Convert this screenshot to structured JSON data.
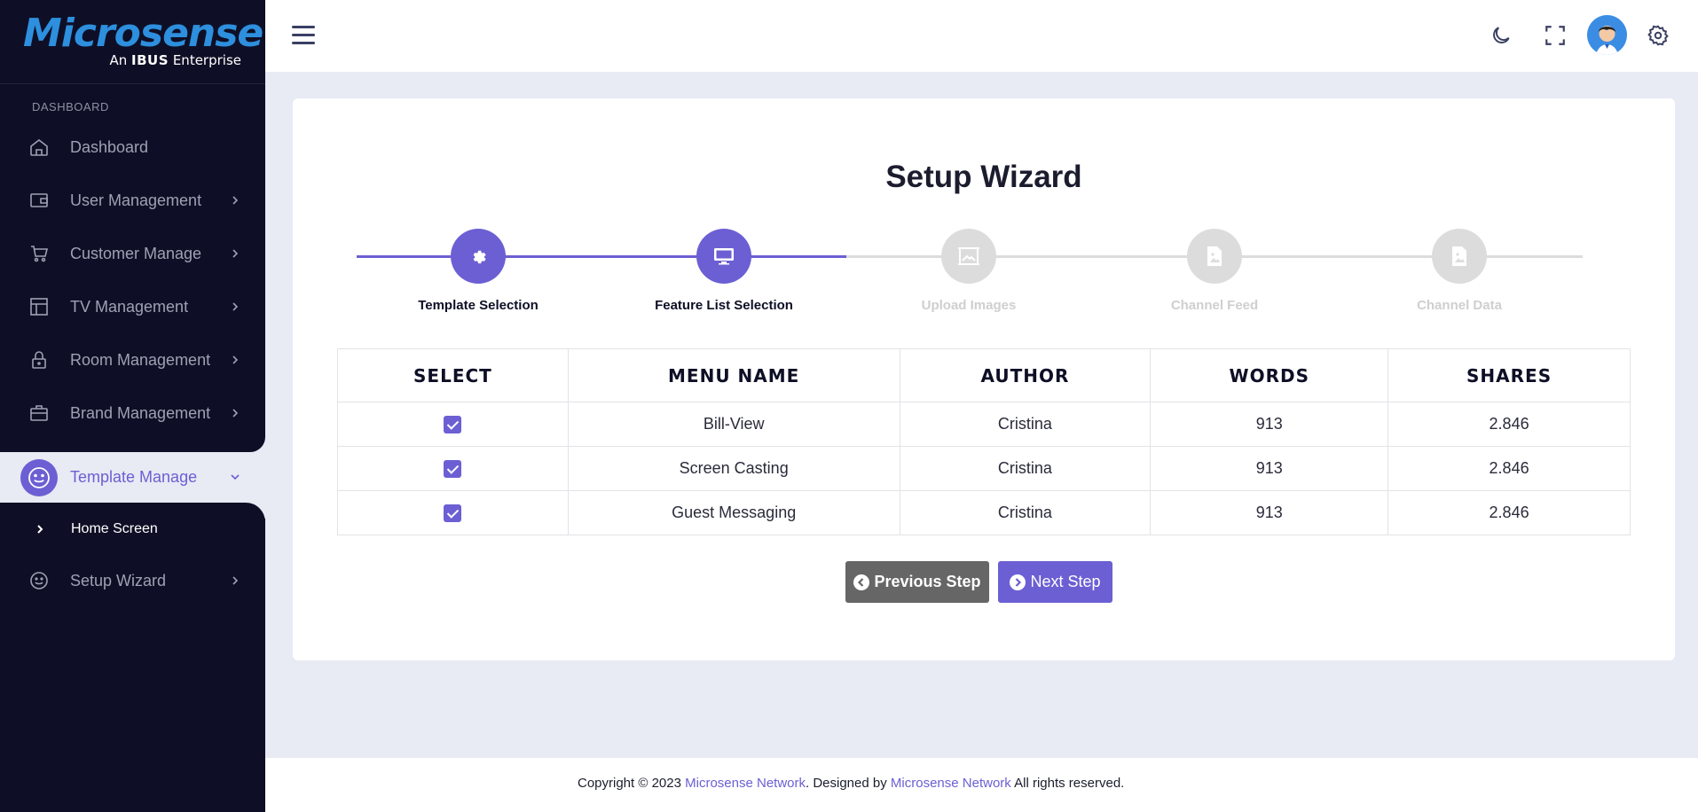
{
  "brand": {
    "name": "Microsense",
    "tagline_prefix": "An",
    "tagline_brand": "IBUS",
    "tagline_suffix": "Enterprise",
    "accent_color": "#6c5fd3",
    "sidebar_bg": "#0e0f26"
  },
  "sidebar": {
    "section_label": "DASHBOARD",
    "items": [
      {
        "label": "Dashboard",
        "icon": "home-icon",
        "has_chevron": false
      },
      {
        "label": "User Management",
        "icon": "wallet-icon",
        "has_chevron": true
      },
      {
        "label": "Customer Manage",
        "icon": "cart-icon",
        "has_chevron": true
      },
      {
        "label": "TV Management",
        "icon": "layout-icon",
        "has_chevron": true
      },
      {
        "label": "Room Management",
        "icon": "lock-icon",
        "has_chevron": true
      },
      {
        "label": "Brand Management",
        "icon": "briefcase-icon",
        "has_chevron": true
      }
    ],
    "active_item": {
      "label": "Template Manage",
      "icon": "smiley-icon"
    },
    "sub_items": [
      {
        "label": "Home Screen"
      }
    ],
    "after_items": [
      {
        "label": "Setup Wizard",
        "icon": "smiley-icon",
        "has_chevron": true
      }
    ]
  },
  "header": {
    "icons": [
      "menu-icon",
      "moon-icon",
      "fullscreen-icon",
      "avatar",
      "settings-icon"
    ]
  },
  "wizard": {
    "title": "Setup Wizard",
    "steps": [
      {
        "label": "Template Selection",
        "status": "done",
        "icon": "gear-icon"
      },
      {
        "label": "Feature List Selection",
        "status": "done",
        "icon": "monitor-icon"
      },
      {
        "label": "Upload Images",
        "status": "todo",
        "icon": "image-frame-icon"
      },
      {
        "label": "Channel Feed",
        "status": "todo",
        "icon": "image-file-icon"
      },
      {
        "label": "Channel Data",
        "status": "todo",
        "icon": "image-file-icon"
      }
    ],
    "table": {
      "columns": [
        "SELECT",
        "MENU NAME",
        "AUTHOR",
        "WORDS",
        "SHARES"
      ],
      "rows": [
        {
          "checked": true,
          "menu_name": "Bill-View",
          "author": "Cristina",
          "words": "913",
          "shares": "2.846"
        },
        {
          "checked": true,
          "menu_name": "Screen Casting",
          "author": "Cristina",
          "words": "913",
          "shares": "2.846"
        },
        {
          "checked": true,
          "menu_name": "Guest Messaging",
          "author": "Cristina",
          "words": "913",
          "shares": "2.846"
        }
      ]
    },
    "buttons": {
      "previous": "Previous Step",
      "next": "Next Step"
    }
  },
  "footer": {
    "copyright": "Copyright © 2023",
    "link1": "Microsense Network",
    "middle": ". Designed by",
    "link2": "Microsense Network",
    "suffix": "All rights reserved."
  }
}
